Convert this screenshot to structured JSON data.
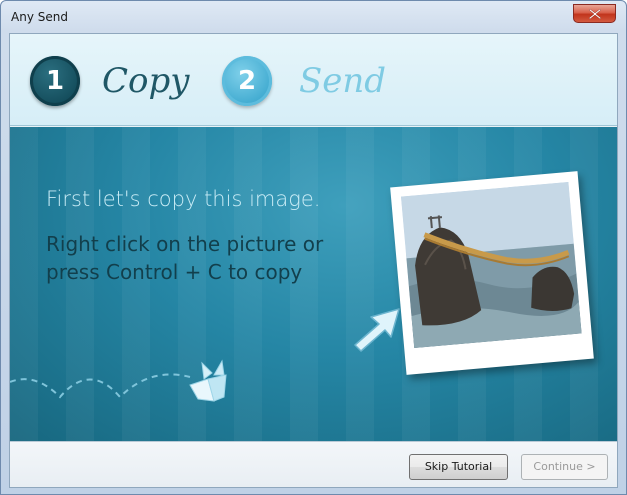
{
  "window": {
    "title": "Any Send"
  },
  "steps": [
    {
      "number": "1",
      "label": "Copy",
      "state": "active"
    },
    {
      "number": "2",
      "label": "Send",
      "state": "inactive"
    }
  ],
  "tutorial": {
    "heading": "First let's copy this image.",
    "instruction": "Right click on the picture or press Control + C to copy"
  },
  "footer": {
    "skip_label": "Skip Tutorial",
    "continue_label": "Continue >"
  },
  "colors": {
    "accent_dark": "#144d5c",
    "accent_light": "#3ea9cf",
    "stage": "#2586a5"
  },
  "icons": {
    "close": "close-icon",
    "plane": "paper-plane-icon",
    "cursor": "arrow-cursor-icon"
  }
}
